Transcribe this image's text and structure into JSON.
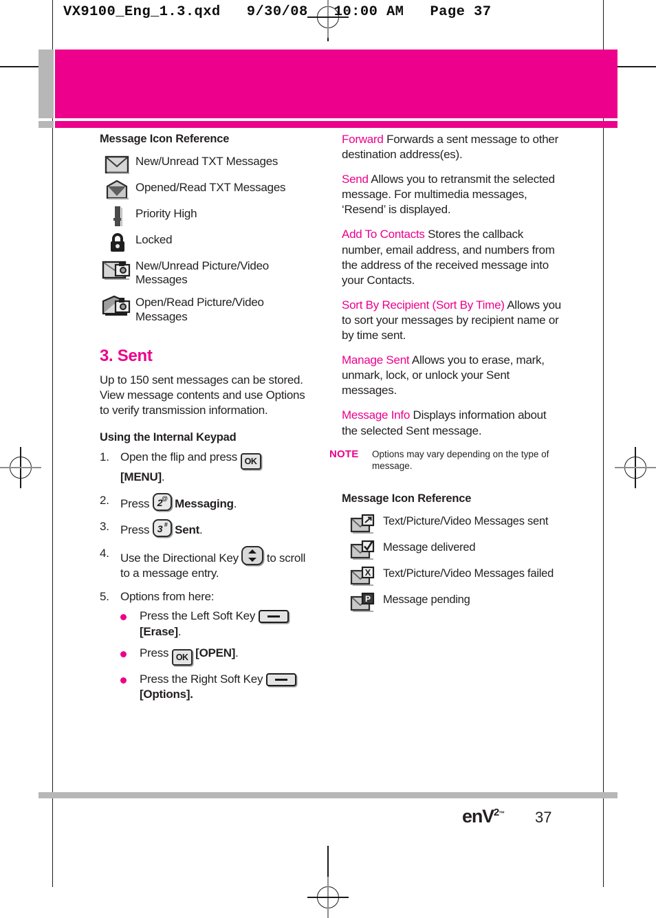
{
  "print_header": "VX9100_Eng_1.3.qxd   9/30/08   10:00 AM   Page 37",
  "colors": {
    "accent": "#ec008c",
    "gray_bar": "#b7b7b7",
    "text": "#231f20"
  },
  "left_column": {
    "icon_reference_heading": "Message Icon Reference",
    "icon_reference": [
      {
        "icon": "envelope-closed-icon",
        "label": "New/Unread TXT Messages"
      },
      {
        "icon": "envelope-open-icon",
        "label": "Opened/Read TXT Messages"
      },
      {
        "icon": "exclamation-priority-icon",
        "label": "Priority High"
      },
      {
        "icon": "padlock-icon",
        "label": "Locked"
      },
      {
        "icon": "envelope-picture-new-icon",
        "label": "New/Unread Picture/Video Messages"
      },
      {
        "icon": "envelope-picture-open-icon",
        "label": "Open/Read Picture/Video Messages"
      }
    ],
    "section_title": "3. Sent",
    "section_body": "Up to 150 sent messages can be stored. View message contents and use Options to verify transmission information.",
    "keypad_heading": "Using the Internal Keypad",
    "steps": [
      {
        "num": "1.",
        "text_before": "Open the flip and press ",
        "key": "ok-key",
        "text_after_bold": "[MENU]",
        "text_end": "."
      },
      {
        "num": "2.",
        "text_before": "Press ",
        "key": "num2-key",
        "text_after_bold": "Messaging",
        "text_end": "."
      },
      {
        "num": "3.",
        "text_before": "Press ",
        "key": "num3-key",
        "text_after_bold": "Sent",
        "text_end": "."
      },
      {
        "num": "4.",
        "text_before": "Use the Directional Key ",
        "key": "directional-key",
        "text_after": " to scroll to a message entry."
      },
      {
        "num": "5.",
        "text_before": "Options from here:"
      }
    ],
    "bullets": [
      {
        "text_before": "Press the Left Soft Key ",
        "key": "soft-key",
        "text_after_bold": "[Erase]",
        "text_end": "."
      },
      {
        "text_before": "Press ",
        "key": "ok-key",
        "text_after_bold": "[OPEN]",
        "text_end": "."
      },
      {
        "text_before": "Press the Right Soft Key ",
        "key": "soft-key",
        "text_after_bold": "[Options].",
        "text_end": ""
      }
    ]
  },
  "right_column": {
    "options": [
      {
        "term": "Forward",
        "desc": " Forwards a sent message to other destination address(es)."
      },
      {
        "term": "Send",
        "desc": " Allows you to retransmit the selected message. For multimedia messages, ‘Resend’ is displayed."
      },
      {
        "term": "Add To Contacts",
        "desc": " Stores the callback number, email address, and numbers from the address of the received message into your Contacts."
      },
      {
        "term": "Sort By Recipient (Sort By Time)",
        "desc": " Allows you to sort your messages by recipient name or by time sent."
      },
      {
        "term": "Manage Sent",
        "desc": " Allows you to erase, mark, unmark, lock, or unlock your Sent messages."
      },
      {
        "term": "Message Info",
        "desc": " Displays information about the selected Sent message."
      }
    ],
    "note_label": "NOTE",
    "note_text": "Options may vary depending on the type of message.",
    "icon_reference_heading": "Message Icon Reference",
    "icon_reference": [
      {
        "icon": "envelope-arrow-sent-icon",
        "label": "Text/Picture/Video Messages sent"
      },
      {
        "icon": "envelope-check-delivered-icon",
        "label": "Message delivered"
      },
      {
        "icon": "envelope-x-failed-icon",
        "label": "Text/Picture/Video Messages failed"
      },
      {
        "icon": "envelope-p-pending-icon",
        "label": "Message pending"
      }
    ]
  },
  "footer": {
    "brand": "enV",
    "brand_sup": "2",
    "brand_tm": "™",
    "page_number": "37"
  }
}
